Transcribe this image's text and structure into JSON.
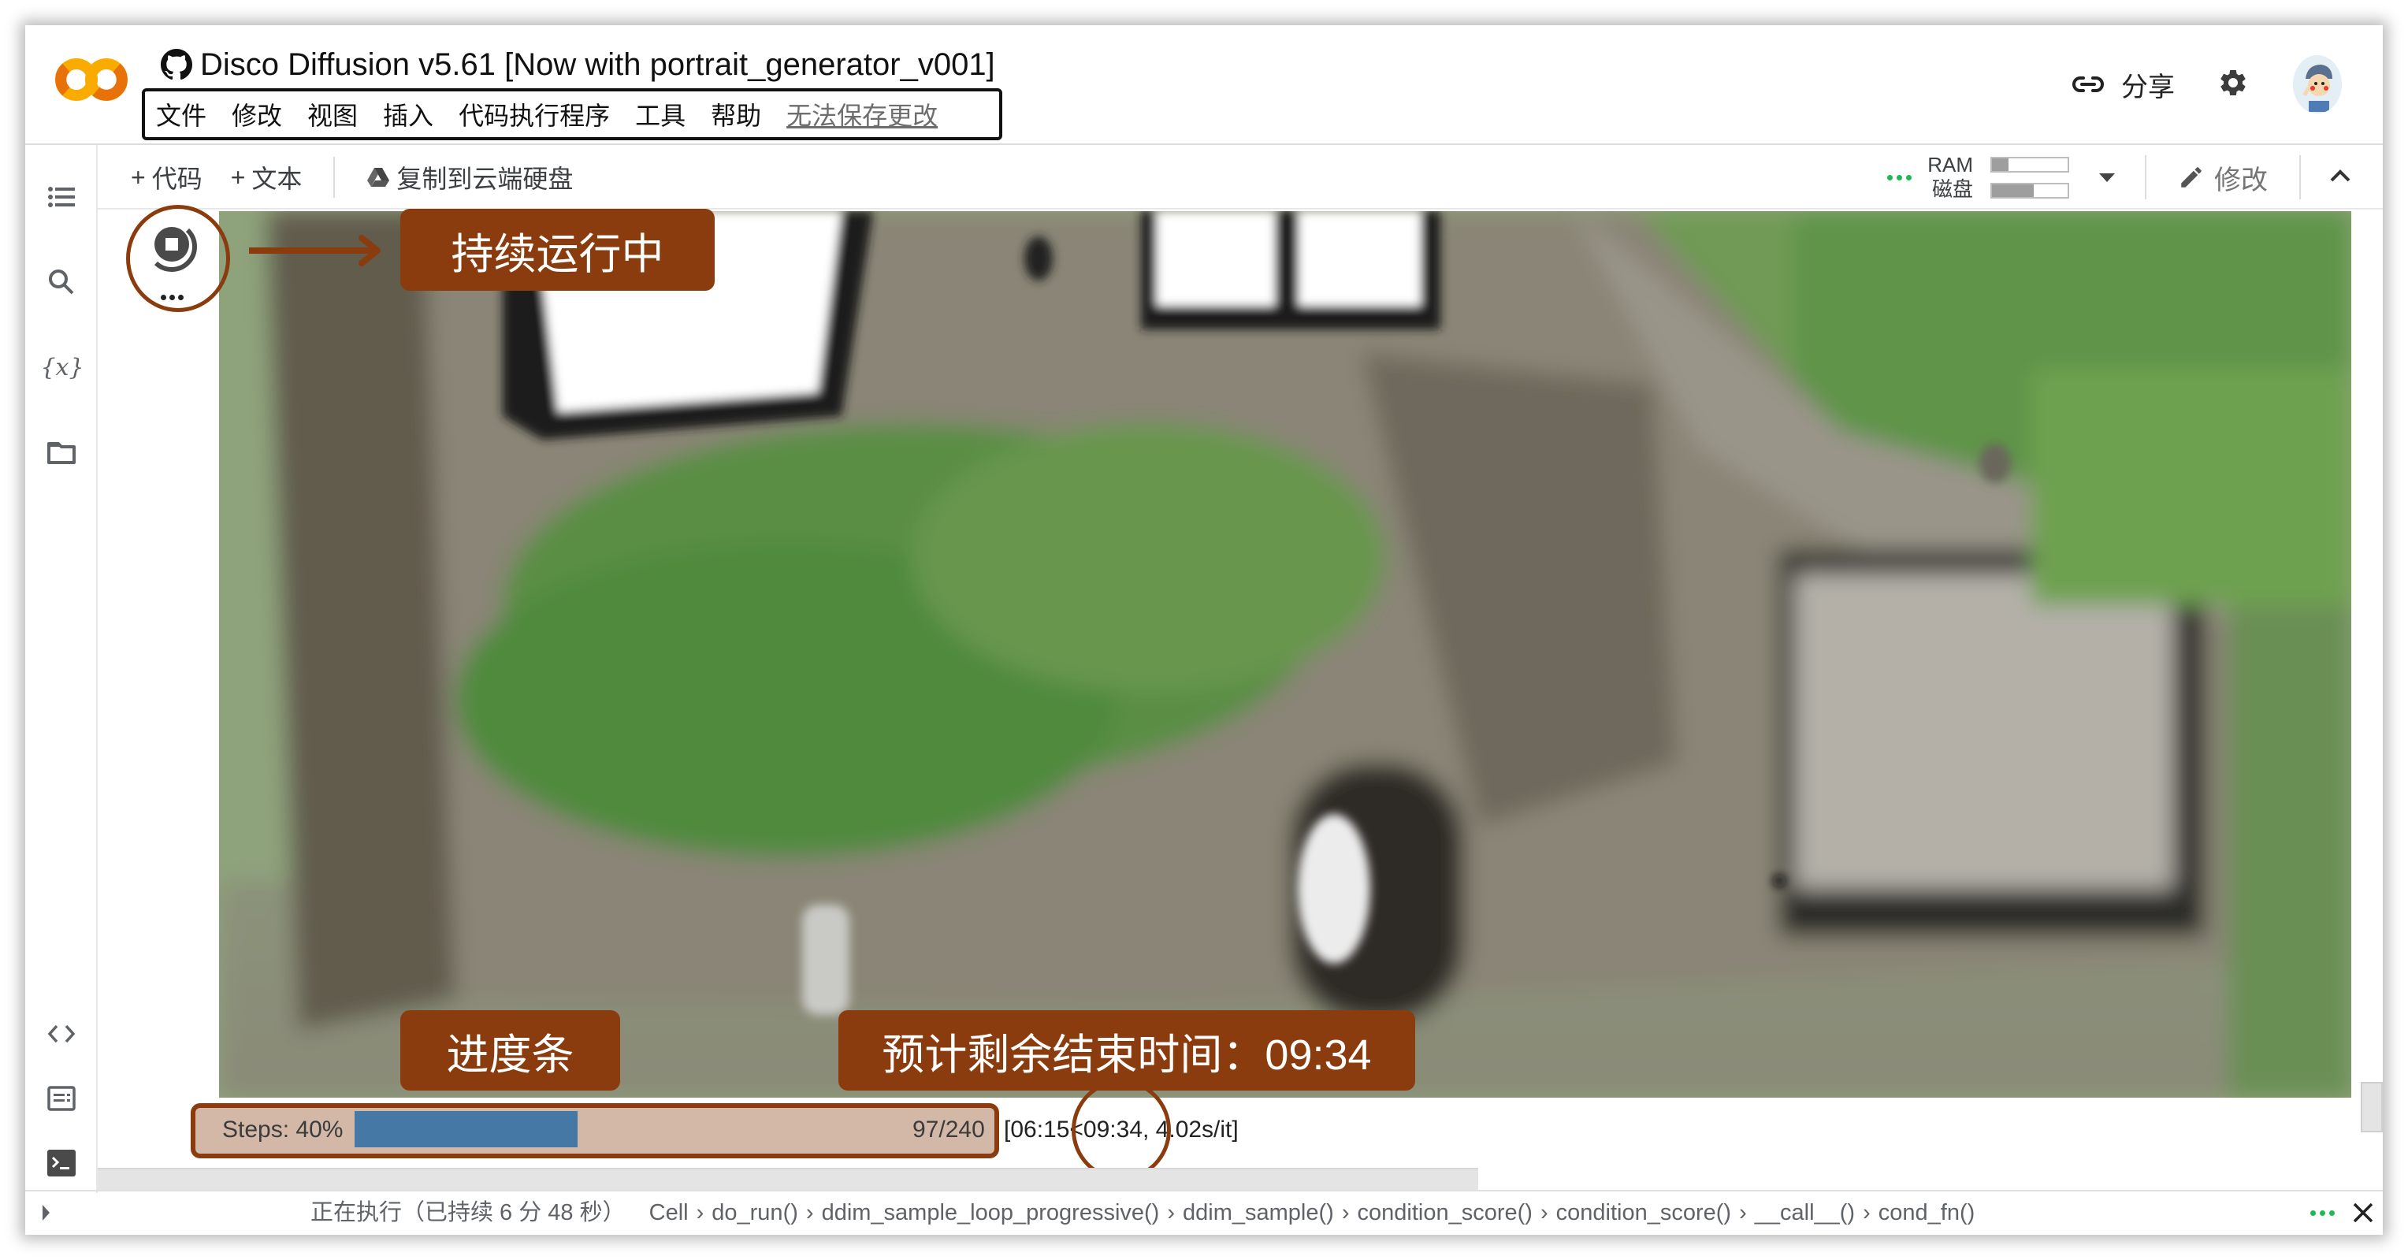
{
  "header": {
    "logo": "colab-logo",
    "title_icon": "github-icon",
    "title": "Disco Diffusion v5.61 [Now with portrait_generator_v001]",
    "menu": [
      {
        "label": "文件"
      },
      {
        "label": "修改"
      },
      {
        "label": "视图"
      },
      {
        "label": "插入"
      },
      {
        "label": "代码执行程序"
      },
      {
        "label": "工具"
      },
      {
        "label": "帮助"
      },
      {
        "label": "无法保存更改",
        "style": "unsaved-link"
      }
    ],
    "share_label": "分享",
    "share_icon": "link-icon",
    "settings_icon": "gear-icon",
    "avatar": "user-avatar"
  },
  "toolbar": {
    "add_code_label": "代码",
    "add_text_label": "文本",
    "copy_to_drive_label": "复制到云端硬盘",
    "ram_label": "RAM",
    "disk_label": "磁盘",
    "ram_usage": 0.22,
    "disk_usage": 0.55,
    "edit_label": "修改",
    "connected_color": "#1db954"
  },
  "sidebar": {
    "items": [
      {
        "name": "table-of-contents",
        "icon": "list-icon"
      },
      {
        "name": "search",
        "icon": "search-icon"
      },
      {
        "name": "variables",
        "icon": "variables-icon",
        "glyph": "{x}"
      },
      {
        "name": "files",
        "icon": "folder-icon"
      },
      {
        "name": "code-snippets",
        "icon": "code-icon"
      },
      {
        "name": "command-palette",
        "icon": "command-palette-icon"
      },
      {
        "name": "terminal",
        "icon": "terminal-icon"
      }
    ]
  },
  "cell": {
    "state": "running",
    "output_image": "generated house overgrown with vegetation on a grassy hill"
  },
  "annotations": {
    "running_label": "持续运行中",
    "progress_label": "进度条",
    "eta_label": "预计剩余结束时间：09:34",
    "color": "#8a3c0e"
  },
  "progress": {
    "label": "Steps: 40%",
    "percent": 40,
    "count": "97/240",
    "current": 97,
    "total": 240,
    "tail": "[06:15<09:34, 4.02s/it]",
    "elapsed": "06:15",
    "remaining": "09:34",
    "rate": "4.02s/it",
    "bar_color": "#4678a5"
  },
  "status": {
    "executing": "正在执行（已持续 6 分 48 秒）",
    "breadcrumbs": [
      "Cell",
      "do_run()",
      "ddim_sample_loop_progressive()",
      "ddim_sample()",
      "condition_score()",
      "condition_score()",
      "__call__()",
      "cond_fn()"
    ]
  }
}
